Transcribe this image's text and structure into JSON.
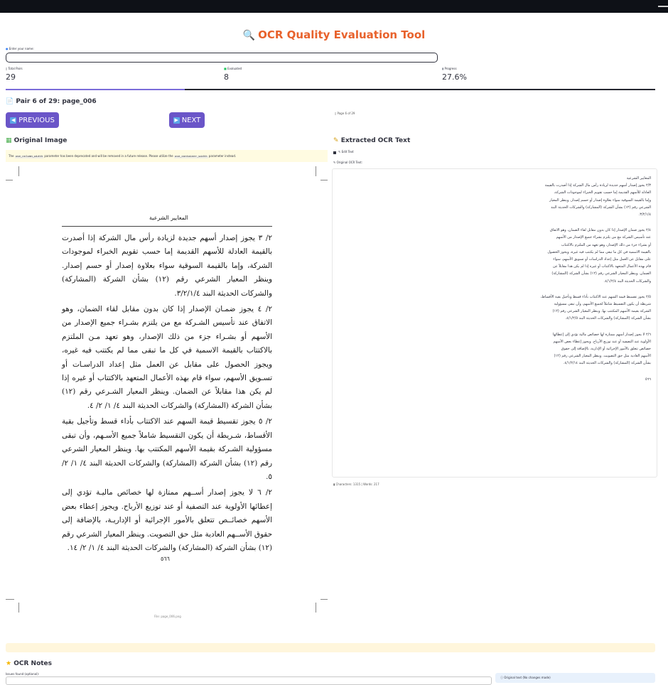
{
  "app": {
    "title": "OCR Quality Evaluation Tool",
    "title_icon": "magnifier-icon"
  },
  "name_field": {
    "label": "Enter your name:",
    "value": "",
    "icon": "person-icon"
  },
  "metrics": [
    {
      "label": "Total Pairs",
      "value": "29",
      "icon": "doc-icon"
    },
    {
      "label": "Evaluated",
      "value": "8",
      "icon": "check-icon"
    },
    {
      "label": "Progress",
      "value": "27.6%",
      "icon": "chart-icon"
    }
  ],
  "progress": {
    "fraction": 0.276,
    "fill_color": "#7b6cd9"
  },
  "pair": {
    "title": "Pair 6 of 29: page_006",
    "page_of": "Page 6 of 29"
  },
  "nav": {
    "previous_label": "PREVIOUS",
    "next_label": "NEXT",
    "button_color": "#6a55c8"
  },
  "original_image": {
    "heading": "Original Image",
    "warning_pre": "The",
    "warning_code1": "use_column_width",
    "warning_mid": "parameter has been deprecated and will be removed in a future release. Please utilize the",
    "warning_code2": "use_container_width",
    "warning_post": "parameter instead.",
    "scan_header": "المعايير الشرعية",
    "scan_paragraphs": [
      "٢/ ٣ يجوز إصدار أسهم جديدة لزيادة رأس مال الشركة إذا أصدرت بالقيمة العادلة للأسهم القديمة إما حسب تقويم الخبراء لموجودات الشركة، وإما بالقيمة السوقية سواء بعلاوة إصدار أو حسم إصدار. وينظر المعيار الشرعي رقم (١٢) بشأن الشركة (المشاركة) والشركات الحديثة البند ٣/٢/١/٤.",
      "٢/ ٤ يجوز ضمـان الإصدار إذا كان بدون مقابل لقاء الضمان، وهو الاتفاق عند تأسيس الشـركة مع من يلتزم بشـراء جميع الإصدار من الأسهم أو بشـراء جزء من ذلك الإصدار، وهو تعهد مـن الملتزم بالاكتتاب بالقيمة الاسمية في كل ما تبقى مما لم يكتتب فيه غيره، ويجوز الحصول على مقابل عن العمل مثل إعداد الدراسـات أو تسـويق الأسهم، سواء قام بهذه الأعمال المتعهد بالاكتتاب أو غيره إذا لم يكن هذا مقابلاً عن الضمان. وينظر المعيار الشـرعي رقم (١٢) بشأن الشركة (المشاركة) والشركات الحديثة البند ٤/ ١/ ٢/ ٤.",
      "٢/ ٥ يجوز تقسيط قيمة السهم عند الاكتتاب بأداء قسط وتأجيل بقية الأقساط، شـريطة أن يكون التقسيط شاملاً جميع الأسـهم، وأن تبقى مسؤولية الشـركة بقيمة الأسهم المكتتب بها. وينظر المعيار الشرعي رقم (١٢) بشأن الشركة (المشاركة) والشركات الحديثة البند ٤/ ١/ ٢/ ٥.",
      "٢/ ٦ لا يجوز إصدار أســهم ممتازة لها خصائص ماليـة تؤدي إلى إعطائها الأولوية عند التصفية أو عند توزيع الأرباح. ويجوز إعطاء بعض الأسهم خصائــص تتعلق بالأمور الإجرائية أو الإداريـة، بالإضافة إلى حقوق الأســهم العادية مثل حق التصويت. وينظر المعيار الشرعي رقم (١٢) بشأن الشركة (المشاركة) والشركات الحديثة البند ٤/ ١/ ٢/ ١٤."
    ],
    "scan_page_number": "٥٦٦",
    "file_caption": "File: page_006.png"
  },
  "ocr": {
    "heading": "Extracted OCR Text",
    "edit_label": "Edit Text",
    "original_label": "Original OCR Text:",
    "paragraphs": [
      "المعايير الشرعية\n٢/٣ يجوز إصدار أسهم جديدة لزيادة رأس مال الشركة إذا أصدرت بالقيمة\nالعادلة للأسهم القديمة إما حسب تقويم الخبراء لموجودات الشركة،\nوإما بالقيمة السوقية سواء بعلاوة إصدار أو حسم إصدار. وينظر المعيار\nالشرعي رقم (١٢) بشأن الشركة (المشاركة) والشركات الحديثة البند\n٣/٢/١/٤.",
      "٢/٤ يجوز ضمان الإصدار إذا كان بدون مقابل لقاء الضمان، وهو الاتفاق\nعند تأسيس الشركة مع من يلتزم بشراء جميع الإصدار من الأسهم\nأو بشراء جزء من ذلك الإصدار، وهو تعهد من الملتزم بالاكتتاب\nبالقيمة الاسمية في كل ما تبقى مما لم يكتتب فيه غيره، ويجوز الحصول\nعلى مقابل عن العمل مثل إعداد الدراسات أو تسويق الأسهم، سواء\nقام بهذه الأعمال المتعهد بالاكتتاب أو غيره إذا لم يكن هذا مقابلاً عن\nالضمان. وينظر المعيار الشرعي رقم (١٢) بشأن الشركة (المشاركة)\nوالشركات الحديثة البند ٤/١/٢/٤.",
      "٢/٥ يجوز تقسيط قيمة السهم عند الاكتتاب بأداء قسط وتأجيل بقية الأقساط،\nشريطة أن يكون التقسيط شاملاً لجميع الأسهم، وأن تبقى مسؤولية\nالشركة بقيمة الأسهم المكتتب بها. وينظر المعيار الشرعي رقم (١٢)\nبشأن الشركة (المشاركة) والشركات الحديثة البند ٤/١/٢/٥.",
      "٢/٦ لا يجوز إصدار أسهم ممتازة لها خصائص مالية تؤدي إلى إعطائها\nالأولوية عند التصفية أو عند توزيع الأرباح. ويجوز إعطاء بعض الأسهم\nخصائص تتعلق بالأمور الإجرائية أو الإدارية، بالإضافة إلى حقوق\nالأسهم العادية مثل حق التصويت. وينظر المعيار الشرعي رقم (١٢)\nبشأن الشركة (المشاركة) والشركات الحديثة البند ٤/١/٢/١٤.",
      "٥٦٦"
    ],
    "stats": "Characters: 1315 | Words: 217"
  },
  "notes": {
    "heading": "OCR Notes",
    "issues_label": "Issues found (optional):",
    "issues_value": "",
    "info_text": "Original text (No changes made)"
  }
}
